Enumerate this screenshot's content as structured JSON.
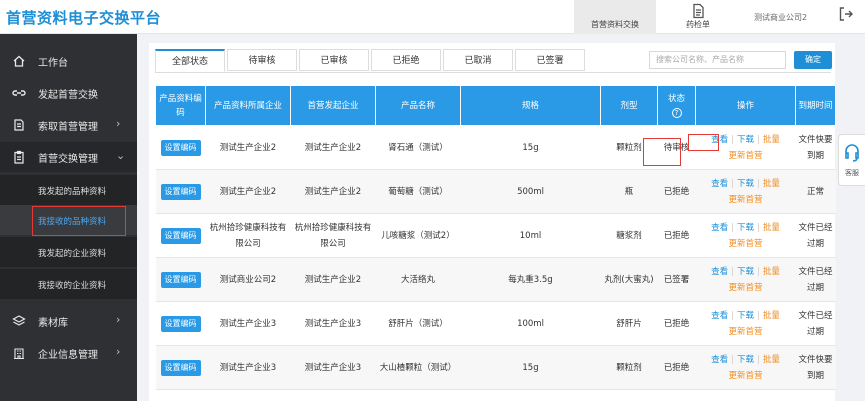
{
  "app": {
    "title": "首营资料电子交换平台"
  },
  "top_nav": [
    {
      "label": "首营资料交换",
      "icon": "exchange-icon"
    },
    {
      "label": "药检单",
      "icon": "document-icon"
    }
  ],
  "user": {
    "name": "测试商业公司2"
  },
  "sidebar": {
    "items": [
      {
        "label": "工作台",
        "icon": "home-icon"
      },
      {
        "label": "发起首营交换",
        "icon": "link-icon"
      },
      {
        "label": "索取首营管理",
        "icon": "request-icon"
      },
      {
        "label": "首营交换管理",
        "icon": "clipboard-icon"
      },
      {
        "label": "素材库",
        "icon": "layers-icon"
      },
      {
        "label": "企业信息管理",
        "icon": "building-icon"
      }
    ],
    "sub_items": [
      {
        "label": "我发起的品种资料"
      },
      {
        "label": "我接收的品种资料"
      },
      {
        "label": "我发起的企业资料"
      },
      {
        "label": "我接收的企业资料"
      }
    ]
  },
  "tabs": [
    "全部状态",
    "待审核",
    "已审核",
    "已拒绝",
    "已取消",
    "已签署"
  ],
  "search": {
    "placeholder": "搜索公司名称、产品名称",
    "confirm_label": "确定"
  },
  "table": {
    "headers": [
      "产品资料编码",
      "产品资料所属企业",
      "首营发起企业",
      "产品名称",
      "规格",
      "剂型",
      "状态",
      "操作",
      "到期时间"
    ],
    "set_code_label": "设置编码",
    "op_labels": {
      "view": "查看",
      "download": "下载",
      "batch": "批量",
      "update": "更新首营"
    },
    "rows": [
      {
        "owner": "测试生产企业2",
        "initiator": "测试生产企业2",
        "product": "肾石通（测试）",
        "spec": "15g",
        "form": "颗粒剂",
        "status": "待审核",
        "expiry": "文件快要到期"
      },
      {
        "owner": "测试生产企业2",
        "initiator": "测试生产企业2",
        "product": "葡萄糖（测试）",
        "spec": "500ml",
        "form": "瓶",
        "status": "已拒绝",
        "expiry": "正常"
      },
      {
        "owner": "杭州拾珍健康科技有限公司",
        "initiator": "杭州拾珍健康科技有限公司",
        "product": "儿咳糖浆（测试2）",
        "spec": "10ml",
        "form": "糖浆剂",
        "status": "已拒绝",
        "expiry": "文件已经过期"
      },
      {
        "owner": "测试商业公司2",
        "initiator": "测试生产企业2",
        "product": "大活络丸",
        "spec": "每丸重3.5g",
        "form": "丸剂(大蜜丸)",
        "status": "已签署",
        "expiry": "文件已经过期"
      },
      {
        "owner": "测试生产企业3",
        "initiator": "测试生产企业3",
        "product": "舒肝片（测试）",
        "spec": "100ml",
        "form": "舒肝片",
        "status": "已拒绝",
        "expiry": "文件已经过期"
      },
      {
        "owner": "测试生产企业3",
        "initiator": "测试生产企业3",
        "product": "大山楂颗粒（测试）",
        "spec": "15g",
        "form": "颗粒剂",
        "status": "已拒绝",
        "expiry": "文件快要到期"
      }
    ]
  },
  "help": {
    "label": "客服"
  },
  "colors": {
    "accent": "#1e8fd6",
    "header": "#2b9ae6",
    "sidebar": "#2f3033",
    "warn": "#f08c1e",
    "highlight": "#e53935"
  }
}
